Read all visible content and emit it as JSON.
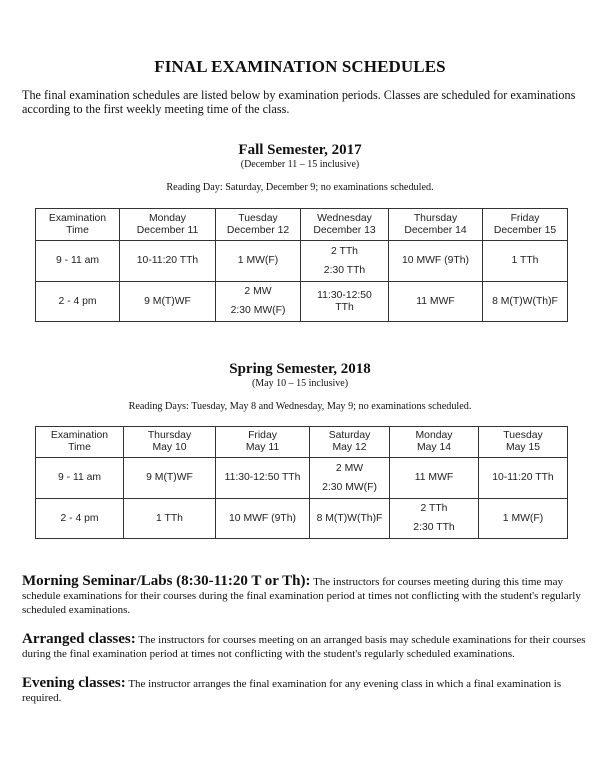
{
  "title": "FINAL EXAMINATION SCHEDULES",
  "intro": "The final examination schedules are listed below by examination periods.  Classes are scheduled for examinations according to the first weekly meeting time of the class.",
  "fall": {
    "title": "Fall Semester, 2017",
    "range": "(December 11 – 15 inclusive)",
    "reading_day": "Reading Day: Saturday, December 9; no examinations scheduled.",
    "headers": [
      {
        "line1": "Examination",
        "line2": "Time"
      },
      {
        "line1": "Monday",
        "line2": "December 11"
      },
      {
        "line1": "Tuesday",
        "line2": "December 12"
      },
      {
        "line1": "Wednesday",
        "line2": "December 13"
      },
      {
        "line1": "Thursday",
        "line2": "December 14"
      },
      {
        "line1": "Friday",
        "line2": "December 15"
      }
    ],
    "rows": [
      {
        "time": "9 - 11 am",
        "cells": [
          {
            "line1": "10-11:20 TTh",
            "line2": ""
          },
          {
            "line1": "1 MW(F)",
            "line2": ""
          },
          {
            "line1": "2 TTh",
            "line2": "2:30 TTh"
          },
          {
            "line1": "10 MWF (9Th)",
            "line2": ""
          },
          {
            "line1": "1 TTh",
            "line2": ""
          }
        ]
      },
      {
        "time": "2 - 4 pm",
        "cells": [
          {
            "line1": "9 M(T)WF",
            "line2": ""
          },
          {
            "line1": "2 MW",
            "line2": "2:30 MW(F)"
          },
          {
            "line1": "11:30-12:50",
            "line2": "TTh",
            "tight": true
          },
          {
            "line1": "11 MWF",
            "line2": ""
          },
          {
            "line1": "8 M(T)W(Th)F",
            "line2": ""
          }
        ]
      }
    ]
  },
  "spring": {
    "title": "Spring Semester, 2018",
    "range": "(May 10 – 15 inclusive)",
    "reading_day": "Reading Days: Tuesday, May 8 and Wednesday, May 9; no examinations scheduled.",
    "headers": [
      {
        "line1": "Examination",
        "line2": "Time"
      },
      {
        "line1": "Thursday",
        "line2": "May 10"
      },
      {
        "line1": "Friday",
        "line2": "May 11"
      },
      {
        "line1": "Saturday",
        "line2": "May 12"
      },
      {
        "line1": "Monday",
        "line2": "May 14"
      },
      {
        "line1": "Tuesday",
        "line2": "May 15"
      }
    ],
    "rows": [
      {
        "time": "9 - 11 am",
        "cells": [
          {
            "line1": "9 M(T)WF",
            "line2": ""
          },
          {
            "line1": "11:30-12:50 TTh",
            "line2": ""
          },
          {
            "line1": "2 MW",
            "line2": "2:30 MW(F)"
          },
          {
            "line1": "11 MWF",
            "line2": ""
          },
          {
            "line1": "10-11:20 TTh",
            "line2": ""
          }
        ]
      },
      {
        "time": "2 - 4 pm",
        "cells": [
          {
            "line1": "1 TTh",
            "line2": ""
          },
          {
            "line1": "10 MWF (9Th)",
            "line2": ""
          },
          {
            "line1": "8 M(T)W(Th)F",
            "line2": ""
          },
          {
            "line1": "2 TTh",
            "line2": "2:30 TTh"
          },
          {
            "line1": "1 MW(F)",
            "line2": ""
          }
        ]
      }
    ]
  },
  "notes": [
    {
      "lead": "Morning Seminar/Labs (8:30-11:20 T or Th):",
      "text": " The instructors for courses meeting during this time may schedule examinations for their courses during the final examination period at times not conflicting with the student's regularly scheduled examinations."
    },
    {
      "lead": "Arranged classes:",
      "text": "  The instructors for courses meeting on an arranged basis may schedule examinations for their courses during the final examination period at times not conflicting with the student's regularly scheduled examinations."
    },
    {
      "lead": "Evening classes:",
      "text": "  The instructor arranges the final examination for any evening class in which a final examination is required."
    }
  ]
}
